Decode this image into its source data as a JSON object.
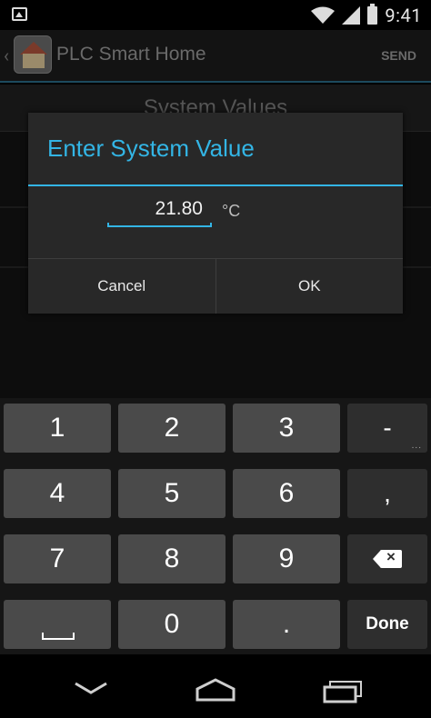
{
  "status_bar": {
    "time": "9:41",
    "icons": [
      "image-icon",
      "wifi-icon",
      "signal-icon",
      "battery-icon"
    ]
  },
  "action_bar": {
    "title": "PLC Smart Home",
    "send_label": "SEND",
    "logo_icon": "house-icon"
  },
  "background": {
    "header_title": "System Values"
  },
  "dialog": {
    "title": "Enter System Value",
    "value": "21.80",
    "unit": "°C",
    "cancel_label": "Cancel",
    "ok_label": "OK"
  },
  "keyboard": {
    "keys": {
      "k1": "1",
      "k2": "2",
      "k3": "3",
      "minus": "-",
      "k4": "4",
      "k5": "5",
      "k6": "6",
      "comma": ",",
      "k7": "7",
      "k8": "8",
      "k9": "9",
      "k0": "0",
      "period": ".",
      "done": "Done"
    },
    "minus_hint": "..."
  },
  "colors": {
    "accent": "#33b5e5",
    "dialog_bg": "#282828",
    "key_num": "#4a4a4a",
    "key_fn": "#2e2e2e"
  }
}
